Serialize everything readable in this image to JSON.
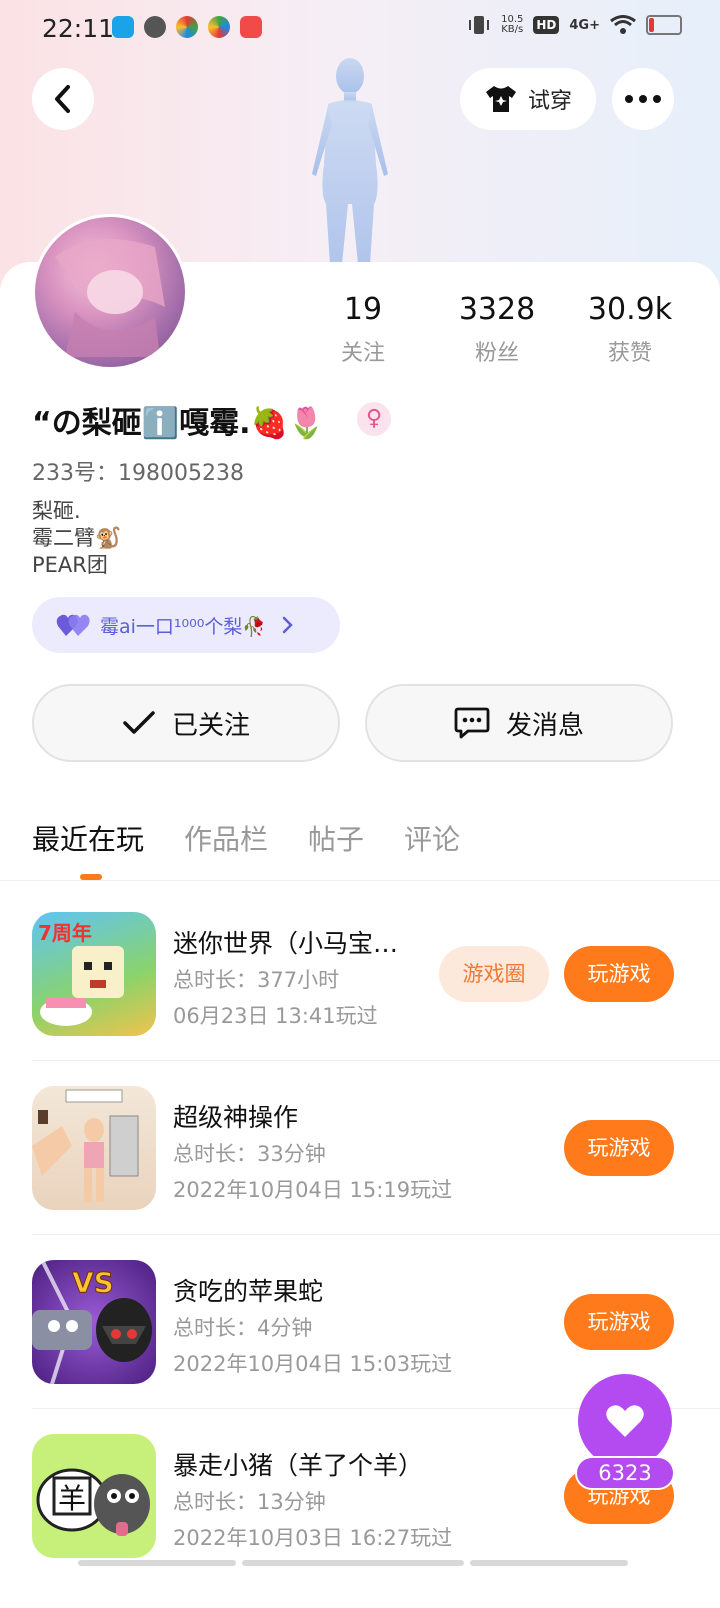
{
  "status_bar": {
    "time": "22:11",
    "net_speed": "10.5",
    "net_unit": "KB/s",
    "hd": "HD",
    "signal": "4G+"
  },
  "header": {
    "try_on_label": "试穿"
  },
  "profile": {
    "name": "“の梨砸ℹ️嘎霉.🍓🌷",
    "id_line": "233号：198005238",
    "bio_lines": [
      "梨砸.",
      "霉二臂🐒",
      "PEAR团"
    ],
    "tag": "霉ai一口¹⁰⁰⁰个梨🥀",
    "stats": [
      {
        "value": "19",
        "label": "关注"
      },
      {
        "value": "3328",
        "label": "粉丝"
      },
      {
        "value": "30.9k",
        "label": "获赞"
      }
    ]
  },
  "actions": {
    "follow_label": "已关注",
    "message_label": "发消息"
  },
  "tabs": [
    "最近在玩",
    "作品栏",
    "帖子",
    "评论"
  ],
  "games": [
    {
      "title": "迷你世界（小马宝…",
      "duration": "总时长：377小时",
      "last_played": "06月23日 13:41玩过",
      "circle_label": "游戏圈",
      "play_label": "玩游戏"
    },
    {
      "title": "超级神操作",
      "duration": "总时长：33分钟",
      "last_played": "2022年10月04日 15:19玩过",
      "play_label": "玩游戏"
    },
    {
      "title": "贪吃的苹果蛇",
      "duration": "总时长：4分钟",
      "last_played": "2022年10月04日 15:03玩过",
      "play_label": "玩游戏"
    },
    {
      "title": "暴走小猪（羊了个羊）",
      "duration": "总时长：13分钟",
      "last_played": "2022年10月03日 16:27玩过",
      "play_label": "玩游戏"
    }
  ],
  "icon_text": {
    "anniversary": "7周年",
    "vs": "VS",
    "sheep_char": "羊"
  },
  "like": {
    "count": "6323"
  },
  "colors": {
    "accent_orange": "#ff7a1a",
    "like_purple": "#b44bf0",
    "tag_blue": "#5c5fd4"
  }
}
